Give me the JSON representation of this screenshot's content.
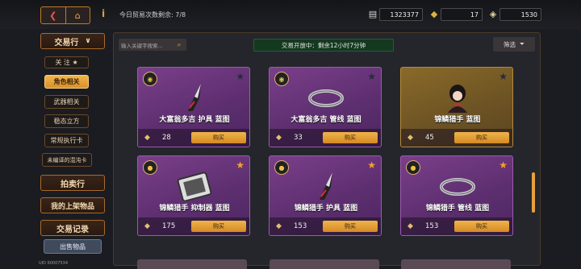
{
  "topbar": {
    "back_icon": "back-arrow-icon",
    "home_icon": "home-icon",
    "info_icon": "info-icon",
    "trade_count_text": "今日贸易次数剩余: 7/8",
    "currencies": [
      {
        "icon": "cash-icon",
        "value": "1323377"
      },
      {
        "icon": "coin-bag-icon",
        "value": "17"
      },
      {
        "icon": "diamond-icon",
        "value": "1530"
      }
    ]
  },
  "sidebar": {
    "exchange": "交易行",
    "exchange_chevron": "chevron-down-icon",
    "items": [
      {
        "label": "关 注 ★"
      },
      {
        "label": "角色相关"
      },
      {
        "label": "武器相关"
      },
      {
        "label": "稳态立方"
      },
      {
        "label": "常规执行卡"
      },
      {
        "label": "未编译的混沌卡"
      }
    ],
    "auction": "拍卖行",
    "my_listings": "我的上架物品",
    "records": "交易记录",
    "sell": "出售物品",
    "uid": "UID 60007534"
  },
  "main": {
    "search_placeholder": "输入关键字搜索...",
    "status_text": "交易开放中：剩余12小时7分钟",
    "filter_label": "筛选",
    "buy_label": "购买",
    "cards": [
      {
        "name": "大富翁多吉 护具 蓝图",
        "price": "28",
        "favorited": false,
        "style": "purple",
        "art": "knife-blade-icon",
        "owner": "doge-avatar"
      },
      {
        "name": "大富翁多吉 管线 蓝图",
        "price": "33",
        "favorited": false,
        "style": "purple",
        "art": "ring-icon",
        "owner": "doge-avatar"
      },
      {
        "name": "锦鳞猎手 蓝图",
        "price": "45",
        "favorited": false,
        "style": "gold",
        "art": "character-portrait",
        "owner": "none"
      },
      {
        "name": "锦鳞猎手 抑制器 蓝图",
        "price": "175",
        "favorited": true,
        "style": "purple",
        "art": "tablet-icon",
        "owner": "hunter-avatar"
      },
      {
        "name": "锦鳞猎手 护具 蓝图",
        "price": "153",
        "favorited": true,
        "style": "purple",
        "art": "knife-blade-icon",
        "owner": "hunter-avatar"
      },
      {
        "name": "锦鳞猎手 管线 蓝图",
        "price": "153",
        "favorited": true,
        "style": "purple",
        "art": "ring-icon",
        "owner": "hunter-avatar"
      }
    ]
  },
  "colors": {
    "accent": "#e6a13a",
    "card_purple": "#6a3580",
    "card_gold": "#7a5e28",
    "status_green": "#14391f"
  }
}
